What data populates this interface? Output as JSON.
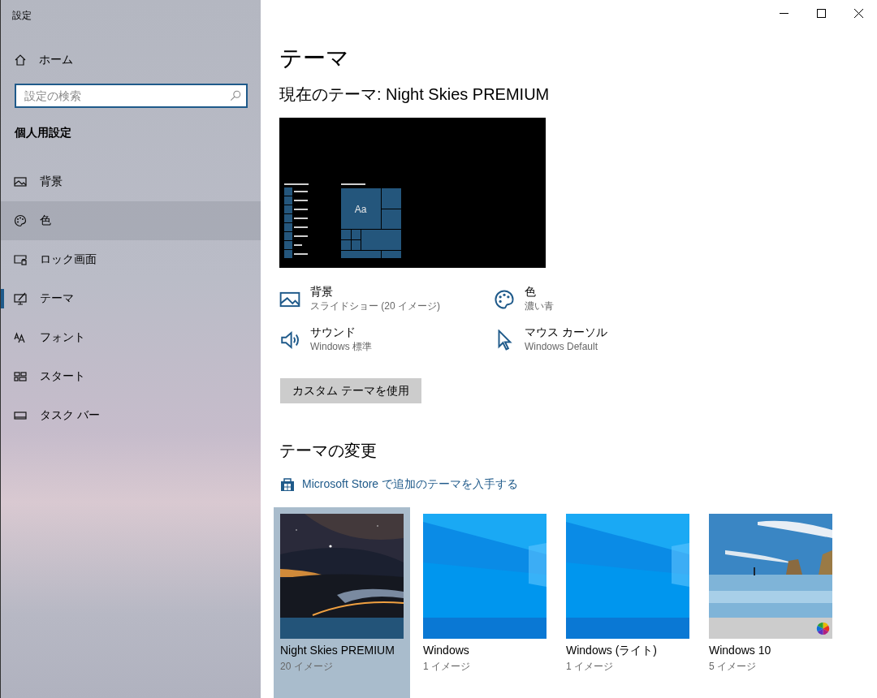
{
  "window": {
    "title": "設定"
  },
  "sidebar": {
    "home": "ホーム",
    "search": {
      "placeholder": "設定の検索"
    },
    "section": "個人用設定",
    "items": [
      {
        "label": "背景",
        "kind": "picture",
        "selected": false,
        "hovered": false
      },
      {
        "label": "色",
        "kind": "palette",
        "selected": false,
        "hovered": true
      },
      {
        "label": "ロック画面",
        "kind": "lock",
        "selected": false,
        "hovered": false
      },
      {
        "label": "テーマ",
        "kind": "theme",
        "selected": true,
        "hovered": false
      },
      {
        "label": "フォント",
        "kind": "font",
        "selected": false,
        "hovered": false
      },
      {
        "label": "スタート",
        "kind": "start",
        "selected": false,
        "hovered": false
      },
      {
        "label": "タスク バー",
        "kind": "taskbar",
        "selected": false,
        "hovered": false
      }
    ]
  },
  "main": {
    "title": "テーマ",
    "current": "現在のテーマ: Night Skies PREMIUM",
    "preview": {
      "tile_text": "Aa"
    },
    "attributes": [
      {
        "kind": "picture",
        "title": "背景",
        "value": "スライドショー (20 イメージ)"
      },
      {
        "kind": "palette",
        "title": "色",
        "value": "濃い青"
      },
      {
        "kind": "sound",
        "title": "サウンド",
        "value": "Windows 標準"
      },
      {
        "kind": "cursor",
        "title": "マウス カーソル",
        "value": "Windows Default"
      }
    ],
    "custom_button": "カスタム テーマを使用",
    "change_title": "テーマの変更",
    "store_link": "Microsoft Store で追加のテーマを入手する",
    "themes": [
      {
        "kind": "night",
        "name": "Night Skies PREMIUM",
        "count": "20 イメージ",
        "selected": true
      },
      {
        "kind": "windows",
        "name": "Windows",
        "count": "1 イメージ",
        "selected": false
      },
      {
        "kind": "windows",
        "name": "Windows (ライト)",
        "count": "1 イメージ",
        "selected": false
      },
      {
        "kind": "beach",
        "name": "Windows 10",
        "count": "5 イメージ",
        "selected": false
      }
    ]
  }
}
